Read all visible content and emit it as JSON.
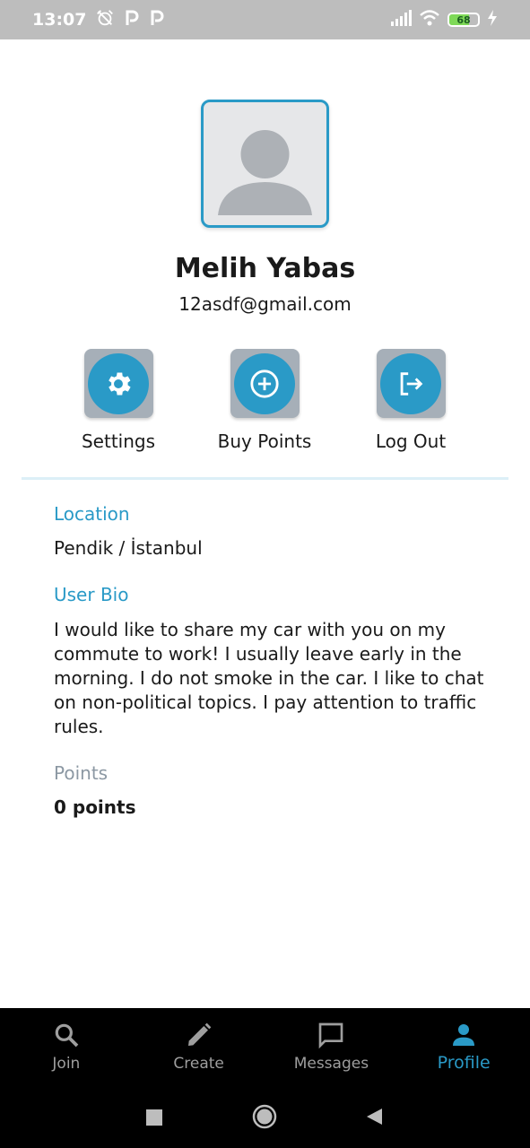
{
  "status_bar": {
    "time": "13:07",
    "notification_icons": [
      "alarm-off-icon",
      "parking-icon",
      "parking-icon"
    ],
    "battery_level": "68"
  },
  "profile": {
    "name": "Melih Yabas",
    "email": "12asdf@gmail.com"
  },
  "actions": [
    {
      "label": "Settings",
      "icon": "gear-icon"
    },
    {
      "label": "Buy Points",
      "icon": "plus-circle-icon"
    },
    {
      "label": "Log Out",
      "icon": "logout-icon"
    }
  ],
  "details": {
    "location_label": "Location",
    "location_value": "Pendik / İstanbul",
    "bio_label": "User Bio",
    "bio_value": "I would like to share my car with you on my commute to work! I usually leave early in the morning. I do not smoke in the car. I like to chat on non-political topics. I pay attention to traffic rules.",
    "points_label": "Points",
    "points_value": "0 points"
  },
  "bottom_nav": {
    "items": [
      {
        "label": "Join",
        "icon": "search-icon"
      },
      {
        "label": "Create",
        "icon": "pencil-icon"
      },
      {
        "label": "Messages",
        "icon": "message-icon"
      },
      {
        "label": "Profile",
        "icon": "person-icon"
      }
    ],
    "active": "Profile"
  },
  "colors": {
    "accent": "#2a9ac7",
    "tile": "#a6afb8",
    "muted_label": "#8c98a3"
  }
}
